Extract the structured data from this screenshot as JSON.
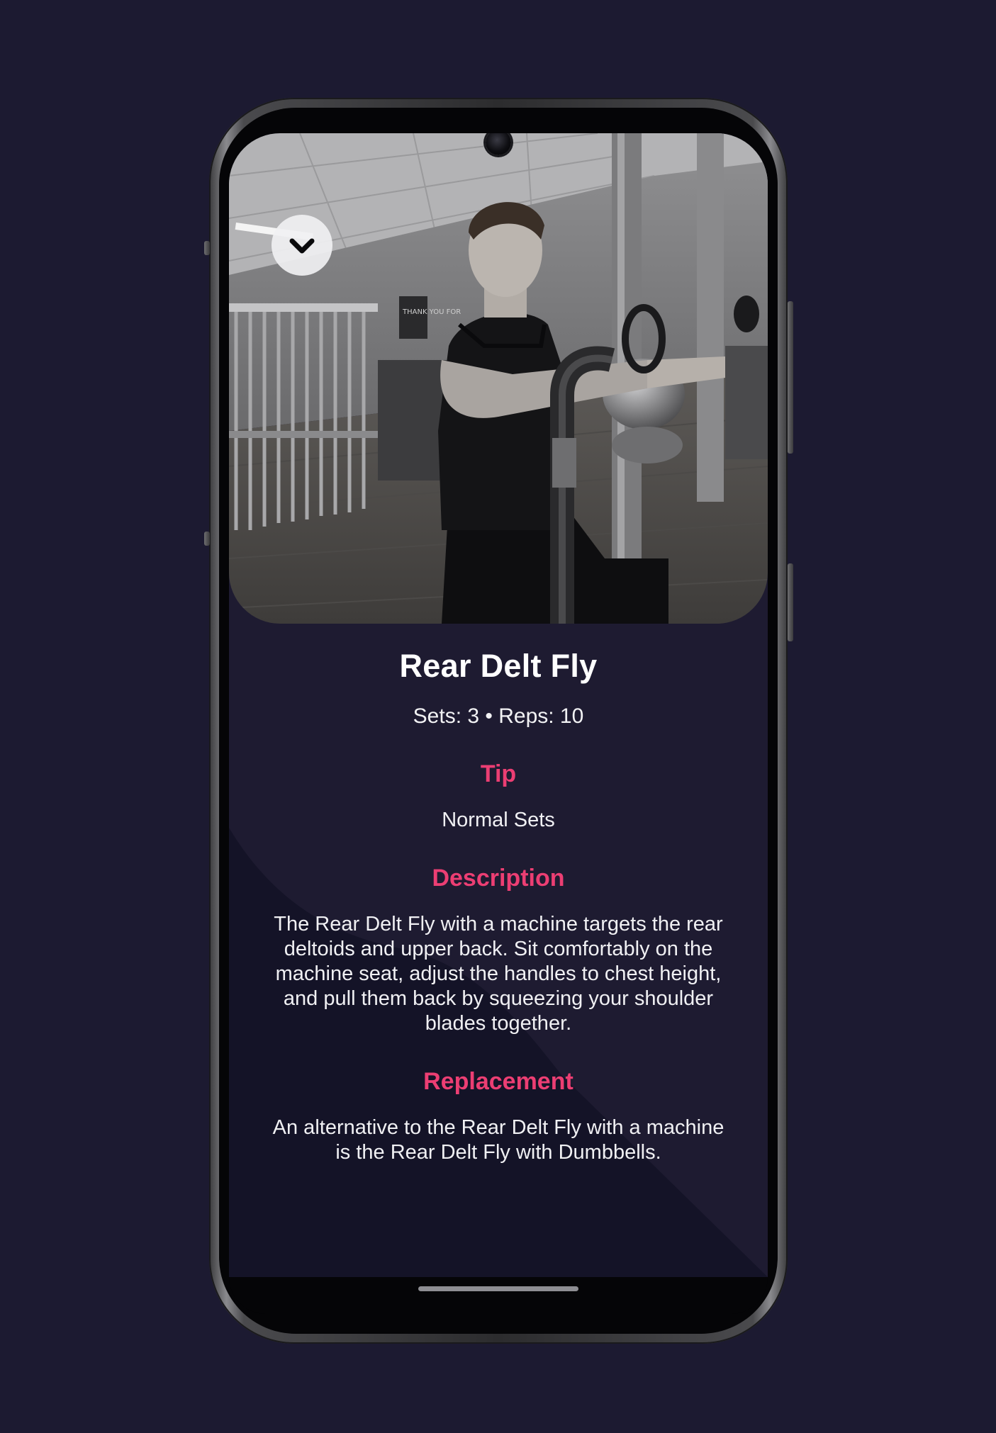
{
  "exercise": {
    "name": "Rear Delt Fly",
    "sets_reps": "Sets: 3 • Reps: 10"
  },
  "tip": {
    "heading": "Tip",
    "text": "Normal Sets"
  },
  "description": {
    "heading": "Description",
    "text": "The Rear Delt Fly with a machine targets the rear deltoids and upper back. Sit comfortably on the machine seat, adjust the handles to chest height, and pull them back by squeezing your shoulder blades together."
  },
  "replacement": {
    "heading": "Replacement",
    "text": "An alternative to the Rear Delt Fly with a machine is the Rear Delt Fly with Dumbbells."
  },
  "photo_sign": "THANK YOU FOR",
  "icons": {
    "collapse": "chevron-down-icon",
    "camera": "front-camera"
  },
  "colors": {
    "background": "#1c1a31",
    "screen_bg": "#1e1b31",
    "accent": "#ec3e73",
    "text": "#ffffff"
  }
}
